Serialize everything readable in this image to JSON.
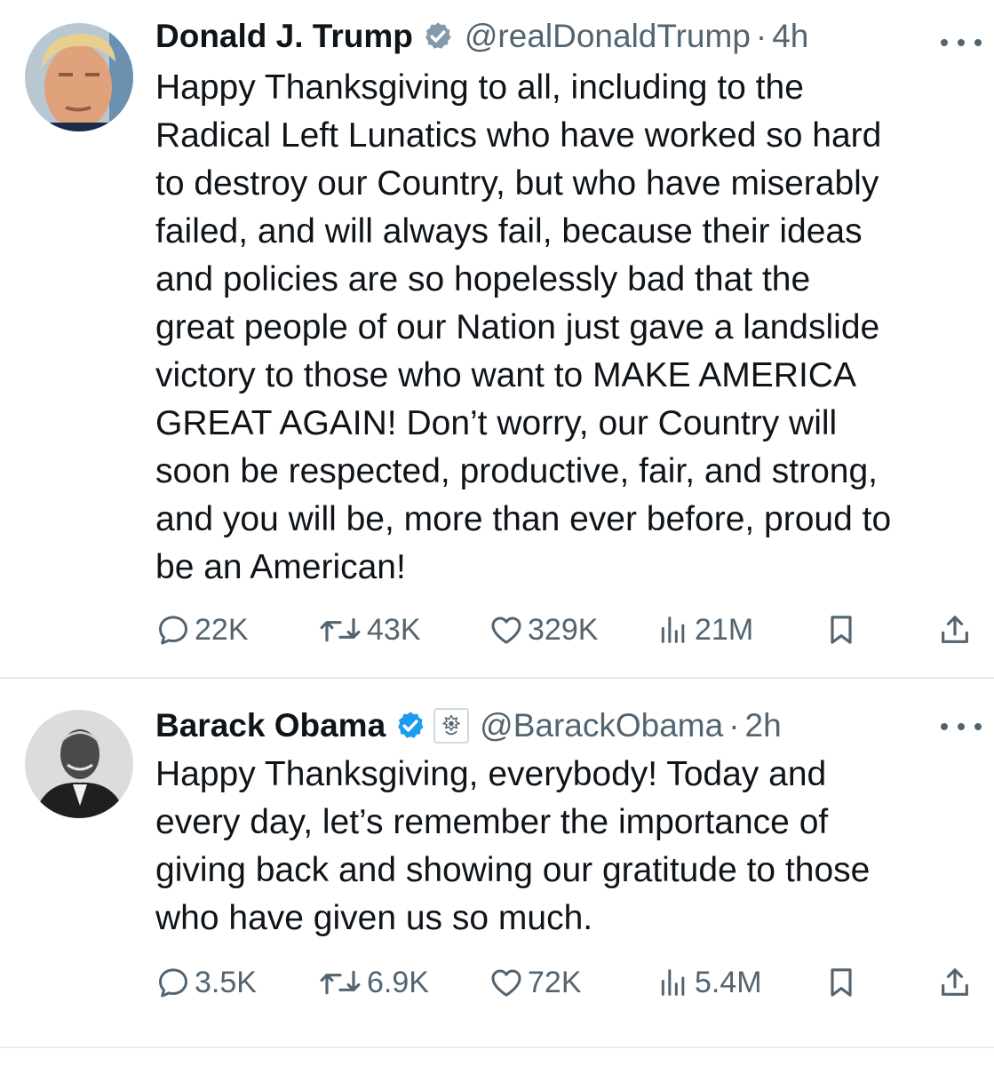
{
  "tweets": [
    {
      "name": "Donald J. Trump",
      "handle": "@realDonaldTrump",
      "separator": "·",
      "time": "4h",
      "text": "Happy Thanksgiving to all, including to the\nRadical Left Lunatics who have worked so hard\nto destroy our Country, but who have miserably\nfailed, and will always fail, because their ideas\nand policies are so hopelessly bad that the\ngreat people of our Nation just gave a landslide\nvictory to those who want to MAKE AMERICA\nGREAT AGAIN! Don’t worry, our Country will\nsoon be respected, productive, fair, and strong,\nand you will be, more than ever before, proud to\nbe an American!",
      "verified_badge_color": "#829aab",
      "stats": {
        "replies": "22K",
        "reposts": "43K",
        "likes": "329K",
        "views": "21M"
      }
    },
    {
      "name": "Barack Obama",
      "handle": "@BarackObama",
      "separator": "·",
      "time": "2h",
      "text": "Happy Thanksgiving, everybody! Today and\nevery day, let’s remember the importance of\ngiving back and showing our gratitude to those\nwho have given us so much.",
      "verified_badge_color": "#1d9bf0",
      "affiliation_icon": "us-seal-icon",
      "stats": {
        "replies": "3.5K",
        "reposts": "6.9K",
        "likes": "72K",
        "views": "5.4M"
      }
    }
  ],
  "colors": {
    "text": "#0f1419",
    "secondary": "#536471",
    "divider": "#e7e9ec",
    "gray_badge": "#829aab",
    "blue_badge": "#1d9bf0"
  }
}
